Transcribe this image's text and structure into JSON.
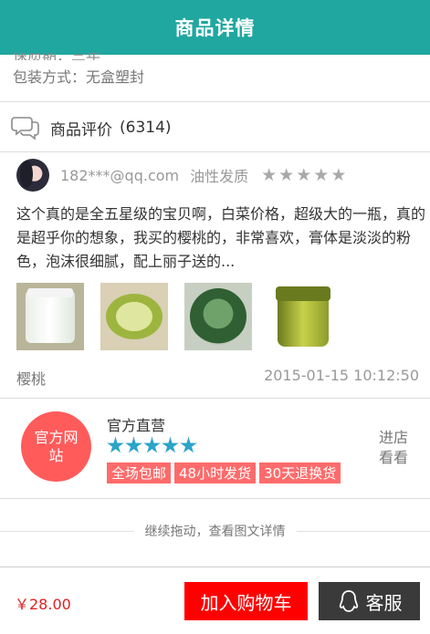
{
  "header": {
    "title": "商品详情"
  },
  "product": {
    "partial_line": "保质期：三年",
    "packaging": "包装方式：无盒塑封"
  },
  "reviews_section": {
    "title": "商品评价",
    "count": "(6314)"
  },
  "review": {
    "user": "182***@qq.com",
    "skin_type": "油性发质",
    "rating": 5,
    "text": "这个真的是全五星级的宝贝啊，白菜价格，超级大的一瓶，真的是超乎你的想象，我买的樱桃的，非常喜欢，膏体是淡淡的粉色，泡沫很细腻，配上丽子送的...",
    "variant": "樱桃",
    "date": "2015-01-15 10:12:50"
  },
  "shop": {
    "badge": "官方网站",
    "name": "官方直营",
    "rating": 5,
    "tags": [
      "全场包邮",
      "48小时发货",
      "30天退换货"
    ],
    "enter_label": "进店看看"
  },
  "more_details": "继续拖动，查看图文详情",
  "bottom_bar": {
    "price": "￥28.00",
    "add_to_cart": "加入购物车",
    "service": "客服"
  },
  "colors": {
    "header": "#1fa7a0",
    "price": "#e02020",
    "cart_button": "#ff0000",
    "service_button": "#3a3a3a",
    "shop_badge": "#ff5b5b",
    "shop_tag": "#ff6b6b",
    "shop_star": "#2aa4c8"
  }
}
